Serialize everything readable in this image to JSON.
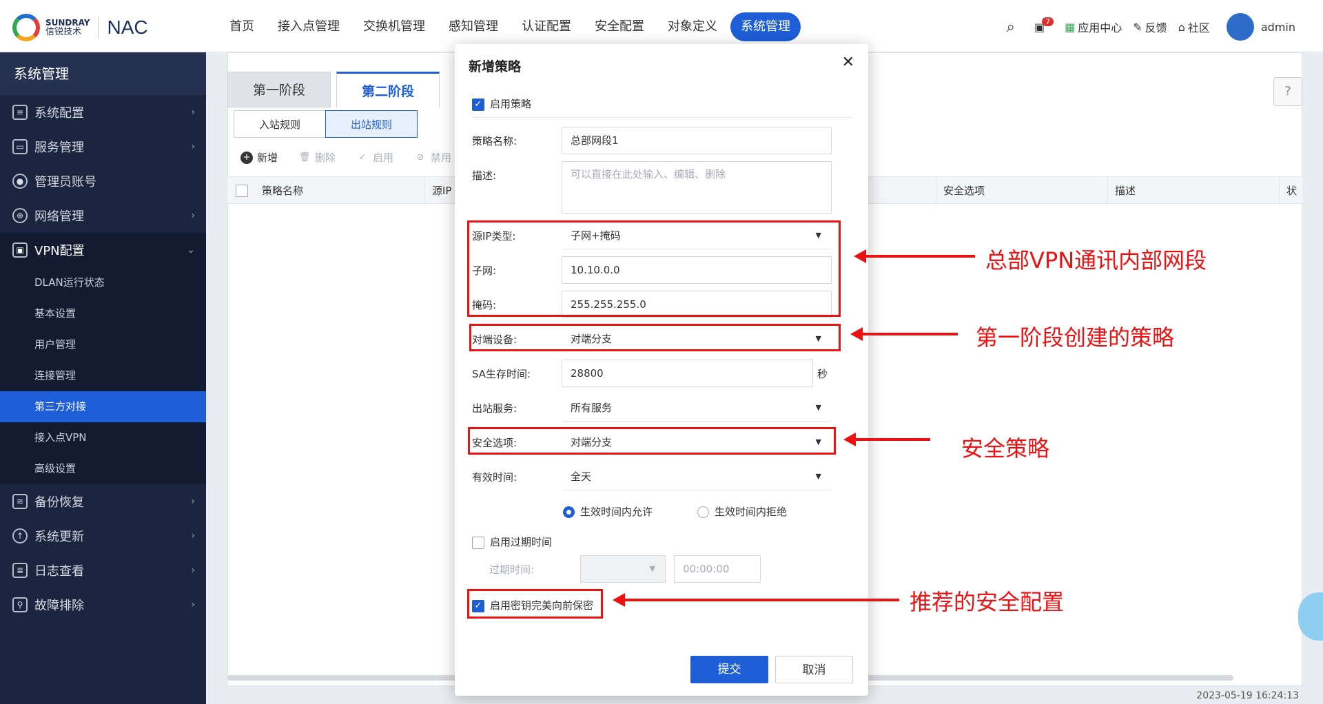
{
  "brand": {
    "en": "SUNDRAY",
    "cn": "信锐技术",
    "product": "NAC"
  },
  "nav": [
    "首页",
    "接入点管理",
    "交换机管理",
    "感知管理",
    "认证配置",
    "安全配置",
    "对象定义",
    "系统管理"
  ],
  "nav_active": "系统管理",
  "top_right": {
    "badge": "7",
    "app_center": "应用中心",
    "feedback": "反馈",
    "community": "社区",
    "user": "admin"
  },
  "sidebar": {
    "title": "系统管理",
    "items_top": [
      "系统配置",
      "服务管理",
      "管理员账号",
      "网络管理"
    ],
    "vpn": "VPN配置",
    "vpn_sub": [
      "DLAN运行状态",
      "基本设置",
      "用户管理",
      "连接管理",
      "第三方对接",
      "接入点VPN",
      "高级设置"
    ],
    "vpn_active": "第三方对接",
    "items_bottom": [
      "备份恢复",
      "系统更新",
      "日志查看",
      "故障排除"
    ]
  },
  "tabs": [
    "第一阶段",
    "第二阶段"
  ],
  "tab_active": "第二阶段",
  "subtabs": [
    "入站规则",
    "出站规则"
  ],
  "subtab_active": "出站规则",
  "toolbar": {
    "add": "新增",
    "delete": "删除",
    "enable": "启用",
    "disable": "禁用"
  },
  "table_headers": {
    "name": "策略名称",
    "src": "源IP",
    "security": "安全选项",
    "desc": "描述",
    "status": "状"
  },
  "timestamp": "2023-05-19 16:24:13",
  "dialog": {
    "title": "新增策略",
    "enable_policy": "启用策略",
    "name_label": "策略名称:",
    "name_value": "总部网段1",
    "desc_label": "描述:",
    "desc_placeholder": "可以直接在此处输入、编辑、删除",
    "src_type_label": "源IP类型:",
    "src_type_value": "子网+掩码",
    "subnet_label": "子网:",
    "subnet_value": "10.10.0.0",
    "mask_label": "掩码:",
    "mask_value": "255.255.255.0",
    "peer_label": "对端设备:",
    "peer_value": "对端分支",
    "sa_label": "SA生存时间:",
    "sa_value": "28800",
    "sa_unit": "秒",
    "service_label": "出站服务:",
    "service_value": "所有服务",
    "security_label": "安全选项:",
    "security_value": "对端分支",
    "valid_label": "有效时间:",
    "valid_value": "全天",
    "radio_allow": "生效时间内允许",
    "radio_deny": "生效时间内拒绝",
    "expire_enable": "启用过期时间",
    "expire_label": "过期时间:",
    "expire_time": "00:00:00",
    "pfs": "启用密钥完美向前保密",
    "submit": "提交",
    "cancel": "取消"
  },
  "annotations": {
    "a1": "总部VPN通讯内部网段",
    "a2": "第一阶段创建的策略",
    "a3": "安全策略",
    "a4": "推荐的安全配置"
  }
}
